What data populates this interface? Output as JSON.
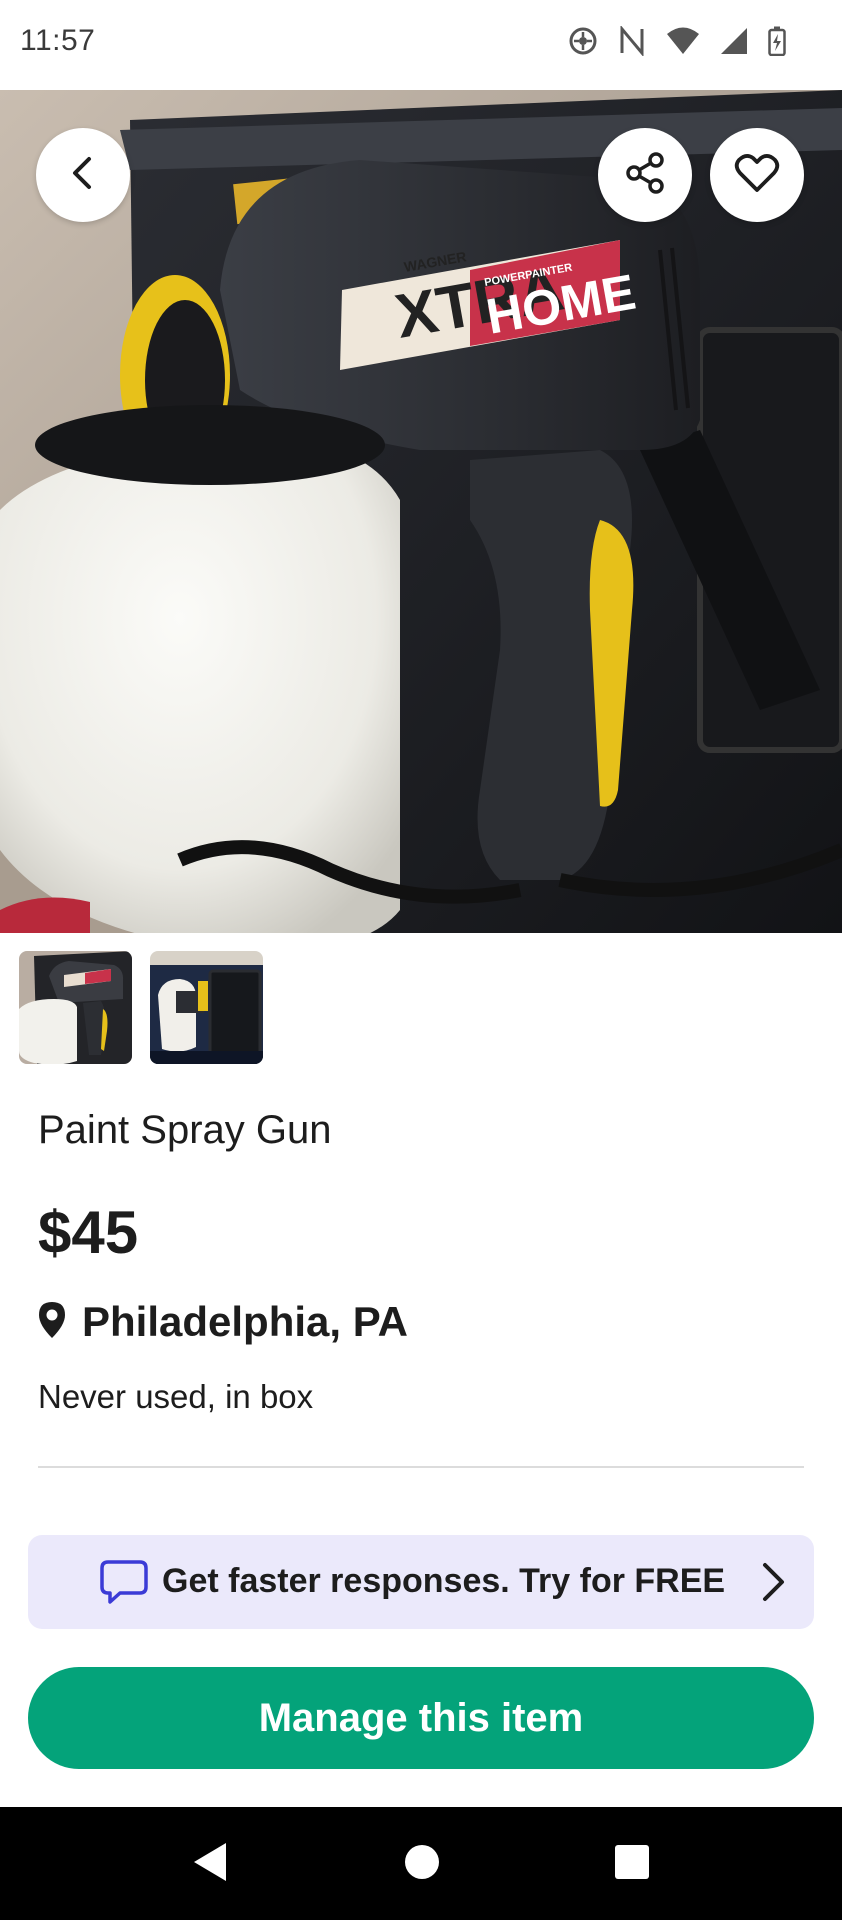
{
  "status_bar": {
    "time": "11:57",
    "icons": [
      "sync-icon",
      "nfc-icon",
      "wifi-icon",
      "cell-signal-icon",
      "battery-charging-icon"
    ]
  },
  "hero": {
    "image": "paint-spray-gun-photo",
    "back_icon": "chevron-left-icon",
    "share_icon": "share-icon",
    "favorite_icon": "heart-outline-icon",
    "product_branding": {
      "brand": "WAGNER",
      "model": "XTRA",
      "line": "HOME",
      "subtitle": "POWERPAINTER"
    }
  },
  "thumbnails": [
    {
      "name": "spray-gun-thumbnail",
      "selected": true
    },
    {
      "name": "case-thumbnail",
      "selected": false
    }
  ],
  "listing": {
    "title": "Paint Spray Gun",
    "price": "$45",
    "location": "Philadelphia, PA",
    "description": "Never used, in box"
  },
  "promo": {
    "text": "Get faster responses. Try for FREE",
    "icon": "chat-bubble-icon",
    "chevron": "chevron-right-icon"
  },
  "actions": {
    "manage_label": "Manage this item"
  },
  "nav": {
    "back": "nav-back-icon",
    "home": "nav-home-icon",
    "recents": "nav-recents-icon"
  },
  "colors": {
    "accent_green": "#04a37a",
    "promo_bg": "#ebe9fb",
    "promo_icon": "#3b3bd6",
    "text": "#1d1d1d"
  }
}
